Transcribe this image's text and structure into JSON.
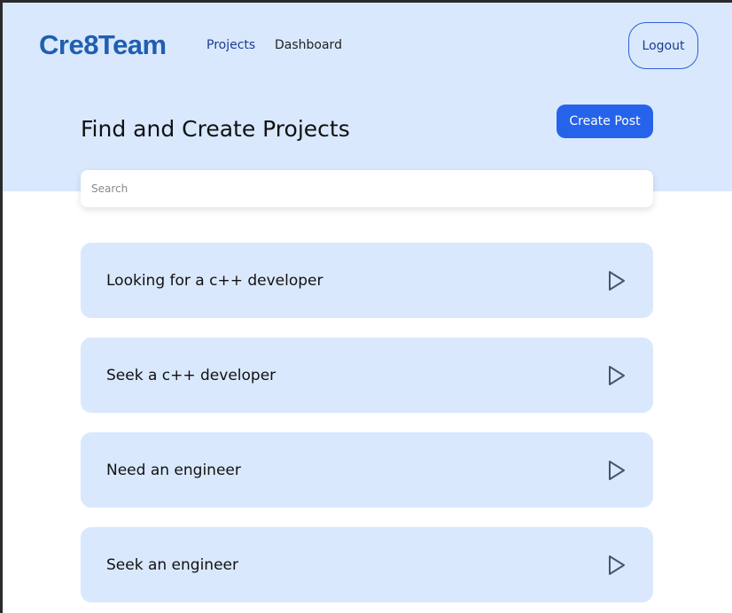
{
  "header": {
    "brand": "Cre8Team",
    "nav": [
      {
        "label": "Projects"
      },
      {
        "label": "Dashboard"
      }
    ],
    "logout_label": "Logout"
  },
  "main": {
    "title": "Find and Create Projects",
    "create_post_label": "Create Post",
    "search": {
      "placeholder": "Search",
      "value": ""
    },
    "posts": [
      {
        "title": "Looking for a c++ developer",
        "icon": "play-icon"
      },
      {
        "title": "Seek a c++ developer",
        "icon": "play-icon"
      },
      {
        "title": "Need an engineer",
        "icon": "play-icon"
      },
      {
        "title": "Seek an engineer",
        "icon": "play-icon"
      }
    ]
  },
  "colors": {
    "hero_background": "#d9e8fd",
    "primary_button": "#2563eb",
    "brand": "#1f5fb0",
    "nav_active": "#1b3d8f"
  }
}
